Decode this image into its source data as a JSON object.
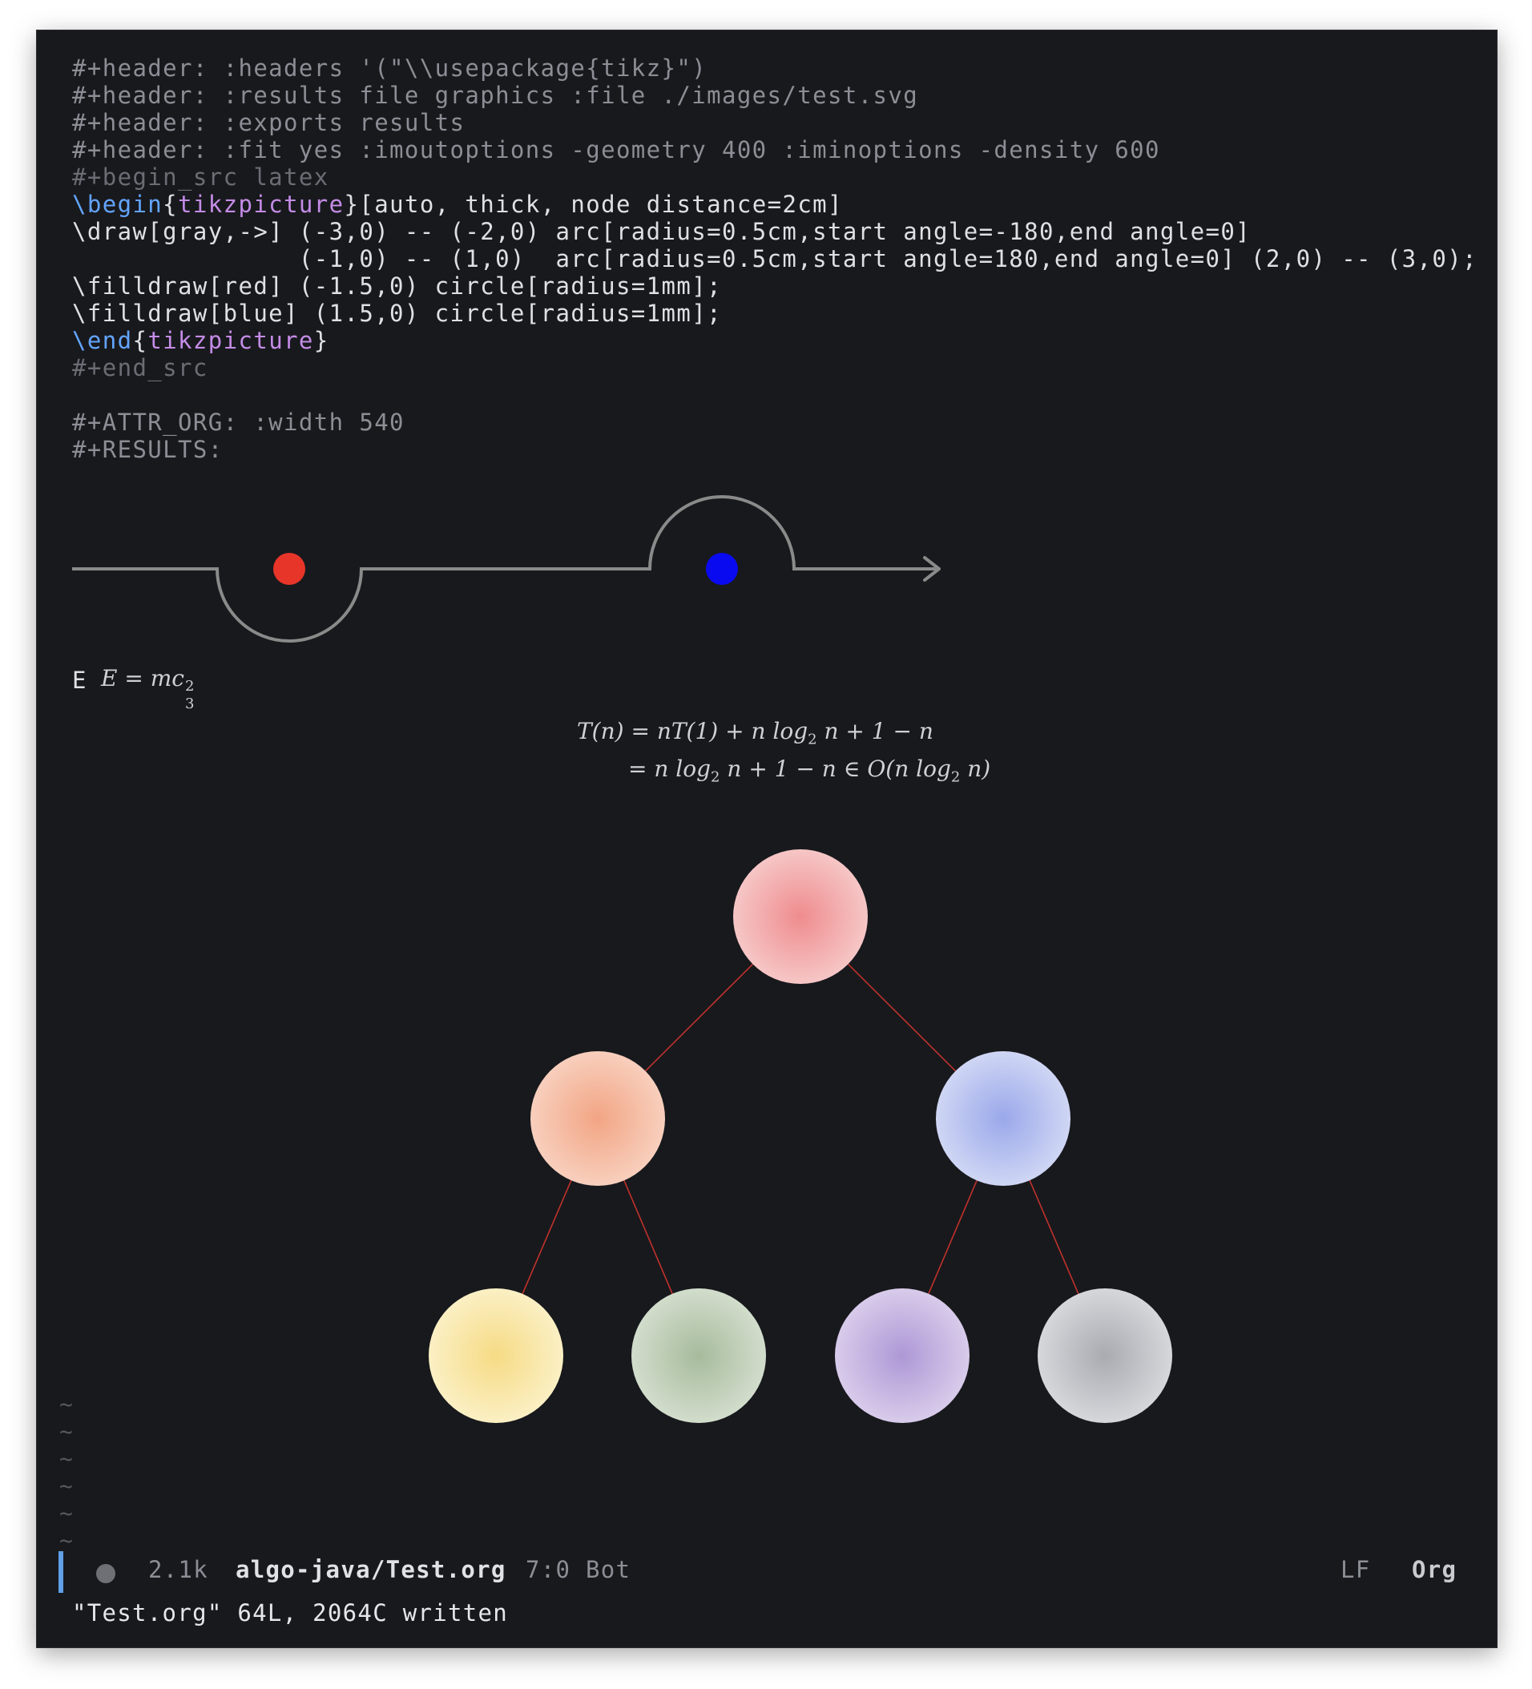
{
  "editor": {
    "code_lines": [
      "#+header: :headers '(\"\\\\usepackage{tikz}\")",
      "#+header: :results file graphics :file ./images/test.svg",
      "#+header: :exports results",
      "#+header: :fit yes :imoutoptions -geometry 400 :iminoptions -density 600",
      "#+begin_src latex"
    ],
    "begin_kw": "\\begin",
    "begin_env": "tikzpicture",
    "begin_args": "[auto, thick, node distance=2cm]",
    "draw_line_1": "\\draw[gray,->] (-3,0) -- (-2,0) arc[radius=0.5cm,start angle=-180,end angle=0]",
    "draw_line_2": "               (-1,0) -- (1,0)  arc[radius=0.5cm,start angle=180,end angle=0] (2,0) -- (3,0);",
    "filldraw_red": "\\filldraw[red] (-1.5,0) circle[radius=1mm];",
    "filldraw_blue": "\\filldraw[blue] (1.5,0) circle[radius=1mm];",
    "end_kw": "\\end",
    "end_env": "tikzpicture",
    "end_src": "#+end_src",
    "attr_org": "#+ATTR_ORG: :width 540",
    "results": "#+RESULTS:"
  },
  "figure": {
    "line_color": "#8a8a8a",
    "red_dot": "#e8352a",
    "blue_dot": "#0a0af0"
  },
  "equations": {
    "inline_label": "E",
    "inline_formula_main": "E = mc",
    "inline_sup": "2",
    "inline_sub": "3",
    "line1_a": "T(n) = nT(1) + n log",
    "line1_sub": "2",
    "line1_b": " n + 1 − n",
    "line2_a": "= n log",
    "line2_sub1": "2",
    "line2_b": " n + 1 − n ∈ O(n log",
    "line2_sub2": "2",
    "line2_c": " n)"
  },
  "tree": {
    "edge_color": "#c0312a",
    "nodes": [
      {
        "id": "root",
        "inner": "#ef8c8e",
        "outer": "#f6c6c6"
      },
      {
        "id": "left",
        "inner": "#f2a584",
        "outer": "#f8cfbd"
      },
      {
        "id": "right",
        "inner": "#9aa8ea",
        "outer": "#cfd6f4"
      },
      {
        "id": "leaf1",
        "inner": "#f6db85",
        "outer": "#fbf0c4"
      },
      {
        "id": "leaf2",
        "inner": "#a7bb9c",
        "outer": "#d2ddcc"
      },
      {
        "id": "leaf3",
        "inner": "#ae98d6",
        "outer": "#d8cbea"
      },
      {
        "id": "leaf4",
        "inner": "#a9abb1",
        "outer": "#d6d7db"
      }
    ]
  },
  "tilde": "~",
  "modeline": {
    "size": "2.1k",
    "buffer": "algo-java/Test.org",
    "position": "7:0 Bot",
    "eol": "LF",
    "mode": "Org"
  },
  "echo": "\"Test.org\" 64L, 2064C written"
}
